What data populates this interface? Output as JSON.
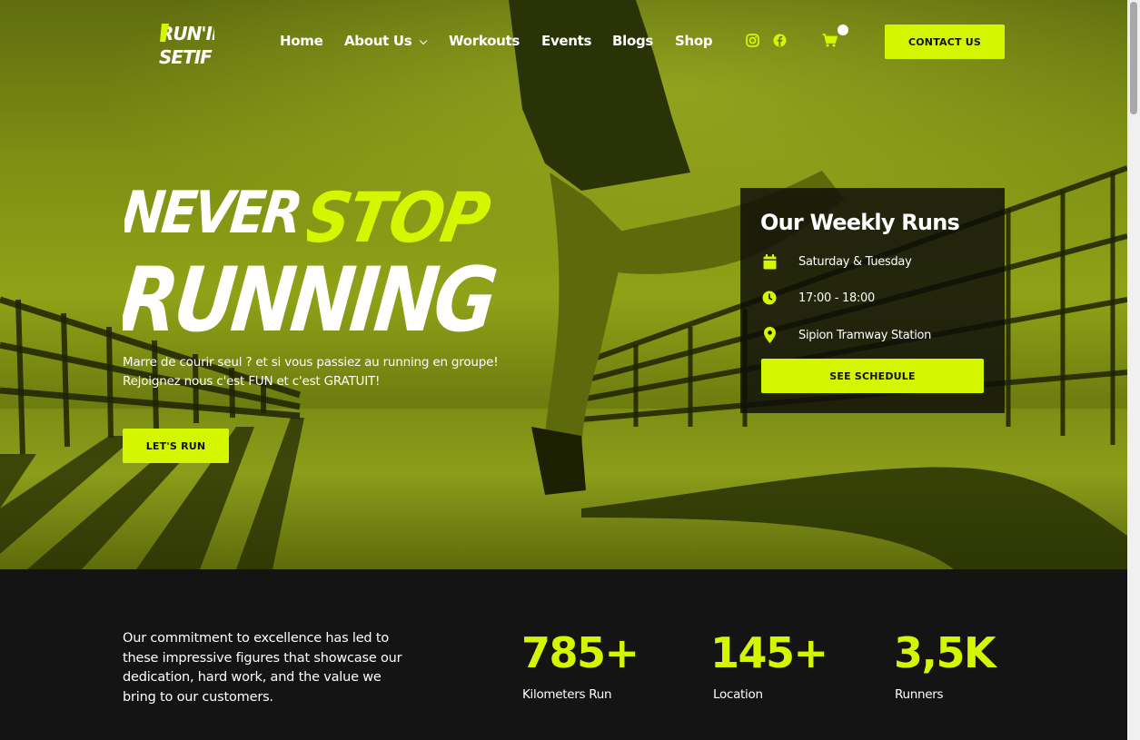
{
  "colors": {
    "accent": "#d4f700",
    "dark": "#141414",
    "white": "#ffffff"
  },
  "header": {
    "logo_alt": "RUN'IN SETIF",
    "nav": [
      {
        "label": "Home"
      },
      {
        "label": "About Us"
      },
      {
        "label": "Workouts"
      },
      {
        "label": "Events"
      },
      {
        "label": "Blogs"
      },
      {
        "label": "Shop"
      }
    ],
    "icons": [
      "instagram-icon",
      "facebook-icon",
      "cart-icon"
    ],
    "contact_label": "CONTACT US"
  },
  "hero": {
    "title_words": [
      "NEVER",
      "STOP",
      "RUNNING"
    ],
    "subtitle_line1": "Marre de courir seul ? et si vous passiez au running en groupe!",
    "subtitle_line2": "Rejoignez nous c'est FUN et c'est GRATUIT!",
    "cta_label": "LET'S RUN"
  },
  "weekly_runs": {
    "title": "Our Weekly Runs",
    "days": "Saturday & Tuesday",
    "time": "17:00 - 18:00",
    "location": "Sipion Tramway Station",
    "button_label": "SEE SCHEDULE"
  },
  "stats": {
    "intro": "Our commitment to excellence has led to these impressive figures that showcase our dedication, hard work, and the value we bring to our customers.",
    "items": [
      {
        "value": "785+",
        "label": "Kilometers Run"
      },
      {
        "value": "145+",
        "label": "Location"
      },
      {
        "value": "3,5K",
        "label": "Runners"
      }
    ]
  }
}
